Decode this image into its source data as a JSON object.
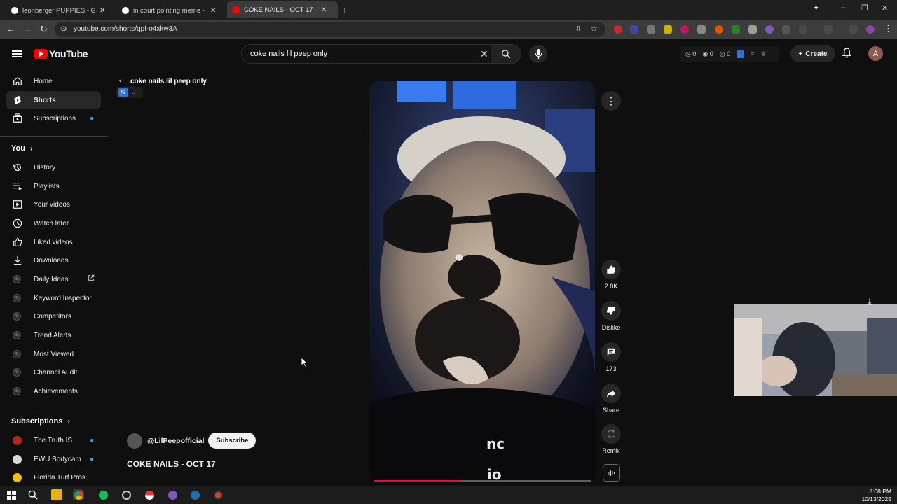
{
  "browser": {
    "tabs": [
      {
        "title": "leonberger PUPPIES - Google S",
        "active": false
      },
      {
        "title": "in court pointing meme - Goog",
        "active": false
      },
      {
        "title": "COKE NAILS - OCT 17 - You",
        "active": true
      }
    ],
    "url": "youtube.com/shorts/qpf-o4xkw3A"
  },
  "masthead": {
    "logo_text": "YouTube",
    "search_value": "coke nails lil peep only",
    "ext_counts": [
      "0",
      "0",
      "0"
    ],
    "create_label": "Create",
    "avatar_letter": "A"
  },
  "sidebar": {
    "main": [
      {
        "label": "Home",
        "icon": "home-icon"
      },
      {
        "label": "Shorts",
        "icon": "shorts-icon",
        "active": true
      },
      {
        "label": "Subscriptions",
        "icon": "subscriptions-icon"
      }
    ],
    "you_heading": "You",
    "you": [
      {
        "label": "History",
        "icon": "history-icon"
      },
      {
        "label": "Playlists",
        "icon": "playlists-icon"
      },
      {
        "label": "Your videos",
        "icon": "your-videos-icon"
      },
      {
        "label": "Watch later",
        "icon": "watch-later-icon"
      },
      {
        "label": "Liked videos",
        "icon": "liked-icon"
      },
      {
        "label": "Downloads",
        "icon": "download-icon"
      }
    ],
    "vidiq": [
      {
        "label": "Daily Ideas"
      },
      {
        "label": "Keyword Inspector"
      },
      {
        "label": "Competitors"
      },
      {
        "label": "Trend Alerts"
      },
      {
        "label": "Most Viewed"
      },
      {
        "label": "Channel Audit"
      },
      {
        "label": "Achievements"
      }
    ],
    "subscriptions_heading": "Subscriptions",
    "subscriptions": [
      {
        "label": "The Truth IS",
        "color": "#b3261e"
      },
      {
        "label": "EWU Bodycam",
        "color": "#d9d9d9"
      },
      {
        "label": "Florida Turf Pros",
        "color": "#f2c200"
      }
    ]
  },
  "short": {
    "topic": "coke nails lil peep only",
    "iq_badge": "IQ",
    "channel_handle": "@LilPeepofficial",
    "subscribe_label": "Subscribe",
    "title": "COKE NAILS - OCT 17",
    "overlay_text": [
      "nc",
      "io"
    ],
    "progress": 0.4,
    "actions": {
      "like_count": "2.8K",
      "dislike_label": "Dislike",
      "comment_count": "173",
      "share_label": "Share",
      "remix_label": "Remix"
    }
  },
  "taskbar": {
    "time": "8:08 PM",
    "date": "10/13/2025"
  },
  "colors": {
    "background": "#0f0f0f",
    "accent_red": "#ff0000",
    "progress_red": "#ff0033",
    "link_blue": "#3ea6ff"
  }
}
